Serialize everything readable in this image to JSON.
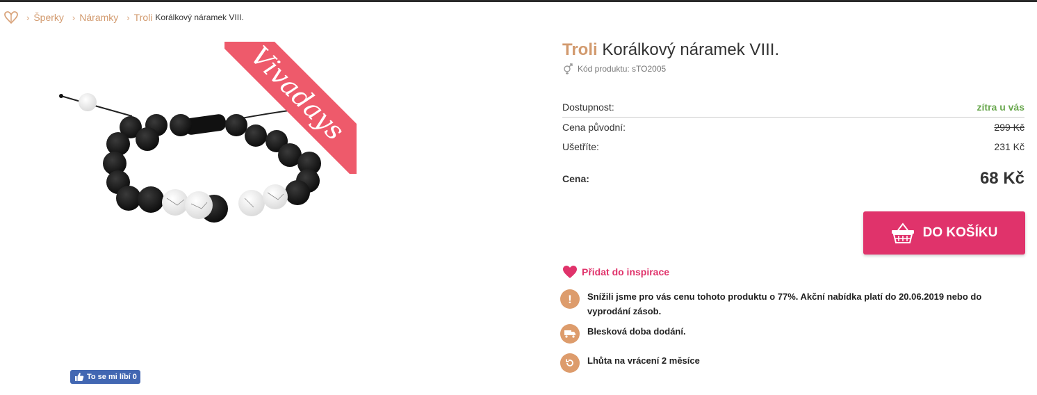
{
  "breadcrumb": {
    "home_icon": "heart-logo-icon",
    "items": [
      "Šperky",
      "Náramky",
      "Troli"
    ],
    "current": "Korálkový náramek VIII."
  },
  "gallery": {
    "badge": "Vivadays",
    "badge_color": "#ee5a6b"
  },
  "facebook": {
    "like_label": "To se mi líbí 0"
  },
  "product": {
    "brand": "Troli",
    "name": "Korálkový náramek VIII.",
    "code_label": "Kód produktu: sTO2005",
    "brand_color": "#d29a6e"
  },
  "info": {
    "availability_label": "Dostupnost:",
    "availability_value": "zítra u vás",
    "original_price_label": "Cena původní:",
    "original_price_value": "299 Kč",
    "savings_label": "Ušetříte:",
    "savings_value": "231 Kč"
  },
  "price": {
    "label": "Cena:",
    "value": "68 Kč"
  },
  "cart": {
    "label": "DO KOŠÍKU",
    "color": "#e0336b"
  },
  "inspiration": {
    "label": "Přidat do inspirace"
  },
  "benefits": [
    {
      "icon": "exclamation-icon",
      "text": "Snížili jsme pro vás cenu tohoto produktu o 77%. Akční nabídka platí do 20.06.2019 nebo do vyprodání zásob."
    },
    {
      "icon": "delivery-truck-icon",
      "text": "Blesková doba dodání."
    },
    {
      "icon": "return-arrow-icon",
      "text": "Lhůta na vrácení 2 měsíce"
    }
  ]
}
